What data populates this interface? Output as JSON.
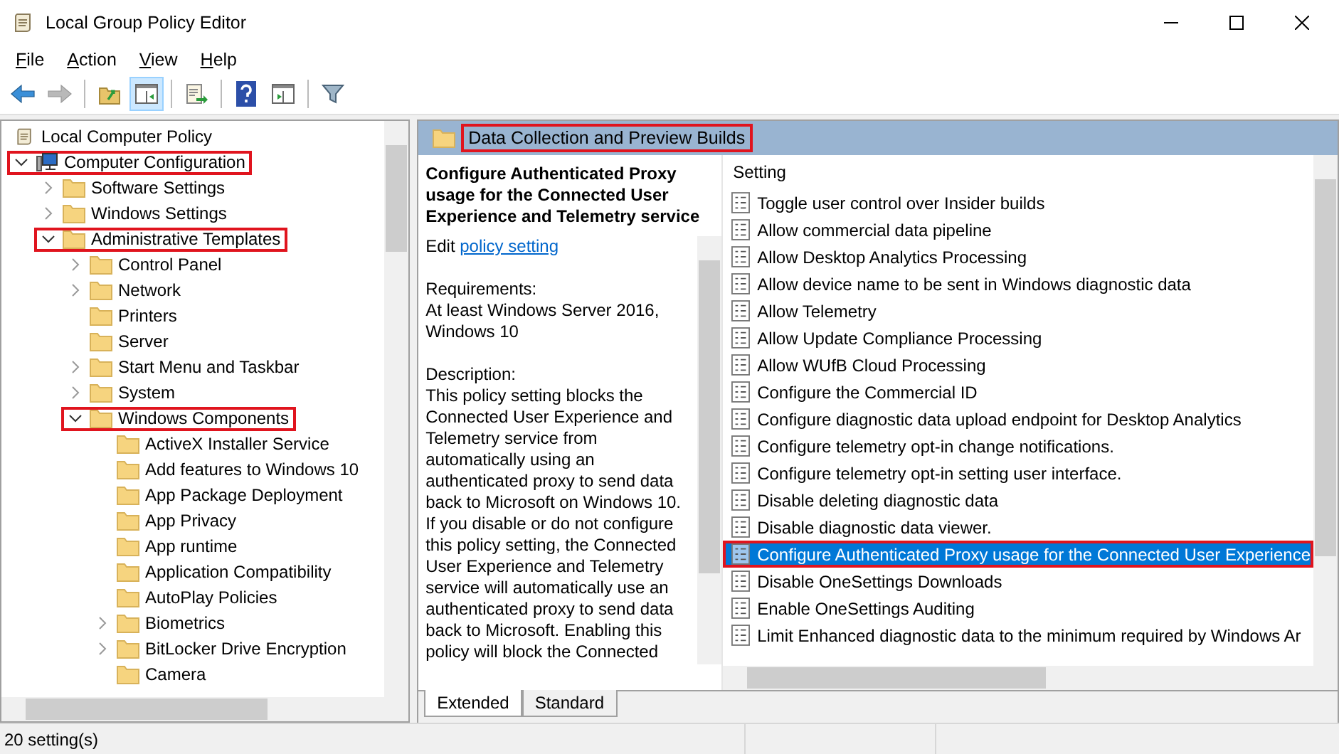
{
  "window": {
    "title": "Local Group Policy Editor"
  },
  "menu": [
    {
      "label": "File"
    },
    {
      "label": "Action"
    },
    {
      "label": "View"
    },
    {
      "label": "Help"
    }
  ],
  "toolbar": [
    [
      {
        "kind": "back",
        "disabled": false,
        "selected": false
      },
      {
        "kind": "forward",
        "disabled": true,
        "selected": false
      }
    ],
    [
      {
        "kind": "up",
        "disabled": false,
        "selected": false
      },
      {
        "kind": "tree",
        "disabled": false,
        "selected": true
      }
    ],
    [
      {
        "kind": "export",
        "disabled": false,
        "selected": false
      }
    ],
    [
      {
        "kind": "help",
        "disabled": false,
        "selected": false
      },
      {
        "kind": "pane",
        "disabled": false,
        "selected": false
      }
    ],
    [
      {
        "kind": "filter",
        "disabled": false,
        "selected": false
      }
    ]
  ],
  "tree": [
    {
      "label": "Local Computer Policy",
      "kind": "policy",
      "expandable": false,
      "highlighted": false,
      "children": [
        {
          "label": "Computer Configuration",
          "kind": "computer",
          "expandable": true,
          "expanded": true,
          "highlighted": true,
          "children": [
            {
              "label": "Software Settings",
              "kind": "folder",
              "expandable": true,
              "expanded": false,
              "highlighted": false
            },
            {
              "label": "Windows Settings",
              "kind": "folder",
              "expandable": true,
              "expanded": false,
              "highlighted": false
            },
            {
              "label": "Administrative Templates",
              "kind": "folder",
              "expandable": true,
              "expanded": true,
              "highlighted": true,
              "children": [
                {
                  "label": "Control Panel",
                  "kind": "folder",
                  "expandable": true,
                  "expanded": false,
                  "highlighted": false
                },
                {
                  "label": "Network",
                  "kind": "folder",
                  "expandable": true,
                  "expanded": false,
                  "highlighted": false
                },
                {
                  "label": "Printers",
                  "kind": "folder",
                  "expandable": false,
                  "highlighted": false
                },
                {
                  "label": "Server",
                  "kind": "folder",
                  "expandable": false,
                  "highlighted": false
                },
                {
                  "label": "Start Menu and Taskbar",
                  "kind": "folder",
                  "expandable": true,
                  "expanded": false,
                  "highlighted": false
                },
                {
                  "label": "System",
                  "kind": "folder",
                  "expandable": true,
                  "expanded": false,
                  "highlighted": false
                },
                {
                  "label": "Windows Components",
                  "kind": "folder",
                  "expandable": true,
                  "expanded": true,
                  "highlighted": true,
                  "children": [
                    {
                      "label": "ActiveX Installer Service",
                      "kind": "folder",
                      "expandable": false,
                      "highlighted": false
                    },
                    {
                      "label": "Add features to Windows 10",
                      "kind": "folder",
                      "expandable": false,
                      "highlighted": false
                    },
                    {
                      "label": "App Package Deployment",
                      "kind": "folder",
                      "expandable": false,
                      "highlighted": false
                    },
                    {
                      "label": "App Privacy",
                      "kind": "folder",
                      "expandable": false,
                      "highlighted": false
                    },
                    {
                      "label": "App runtime",
                      "kind": "folder",
                      "expandable": false,
                      "highlighted": false
                    },
                    {
                      "label": "Application Compatibility",
                      "kind": "folder",
                      "expandable": false,
                      "highlighted": false
                    },
                    {
                      "label": "AutoPlay Policies",
                      "kind": "folder",
                      "expandable": false,
                      "highlighted": false
                    },
                    {
                      "label": "Biometrics",
                      "kind": "folder",
                      "expandable": true,
                      "expanded": false,
                      "highlighted": false
                    },
                    {
                      "label": "BitLocker Drive Encryption",
                      "kind": "folder",
                      "expandable": true,
                      "expanded": false,
                      "highlighted": false
                    },
                    {
                      "label": "Camera",
                      "kind": "folder",
                      "expandable": false,
                      "highlighted": false
                    }
                  ]
                }
              ]
            }
          ]
        }
      ]
    }
  ],
  "detail": {
    "folder_title": "Data Collection and Preview Builds",
    "folder_highlighted": true,
    "policy_title": "Configure Authenticated Proxy usage for the Connected User Experience and Telemetry service",
    "edit_prefix": "Edit",
    "edit_link": "policy setting",
    "requirements_label": "Requirements:",
    "requirements": "At least Windows Server 2016, Windows 10",
    "description_label": "Description:",
    "description": "This policy setting blocks the Connected User Experience and Telemetry service from automatically using an authenticated proxy to send data back to Microsoft on Windows 10. If you disable or do not configure this policy setting, the Connected User Experience and Telemetry service will automatically use an authenticated proxy to send data back to Microsoft. Enabling this policy will block the Connected"
  },
  "settings": {
    "column": "Setting",
    "rows": [
      {
        "label": "Toggle user control over Insider builds",
        "selected": false,
        "highlighted": false
      },
      {
        "label": "Allow commercial data pipeline",
        "selected": false,
        "highlighted": false
      },
      {
        "label": "Allow Desktop Analytics Processing",
        "selected": false,
        "highlighted": false
      },
      {
        "label": "Allow device name to be sent in Windows diagnostic data",
        "selected": false,
        "highlighted": false
      },
      {
        "label": "Allow Telemetry",
        "selected": false,
        "highlighted": false
      },
      {
        "label": "Allow Update Compliance Processing",
        "selected": false,
        "highlighted": false
      },
      {
        "label": "Allow WUfB Cloud Processing",
        "selected": false,
        "highlighted": false
      },
      {
        "label": "Configure the Commercial ID",
        "selected": false,
        "highlighted": false
      },
      {
        "label": "Configure diagnostic data upload endpoint for Desktop Analytics",
        "selected": false,
        "highlighted": false
      },
      {
        "label": "Configure telemetry opt-in change notifications.",
        "selected": false,
        "highlighted": false
      },
      {
        "label": "Configure telemetry opt-in setting user interface.",
        "selected": false,
        "highlighted": false
      },
      {
        "label": "Disable deleting diagnostic data",
        "selected": false,
        "highlighted": false
      },
      {
        "label": "Disable diagnostic data viewer.",
        "selected": false,
        "highlighted": false
      },
      {
        "label": "Configure Authenticated Proxy usage for the Connected User Experience",
        "selected": true,
        "highlighted": true
      },
      {
        "label": "Disable OneSettings Downloads",
        "selected": false,
        "highlighted": false
      },
      {
        "label": "Enable OneSettings Auditing",
        "selected": false,
        "highlighted": false
      },
      {
        "label": "Limit Enhanced diagnostic data to the minimum required by Windows Ar",
        "selected": false,
        "highlighted": false
      }
    ]
  },
  "view_tabs": [
    {
      "label": "Extended",
      "selected": true
    },
    {
      "label": "Standard",
      "selected": false
    }
  ],
  "status_bar": {
    "text": "20 setting(s)"
  }
}
